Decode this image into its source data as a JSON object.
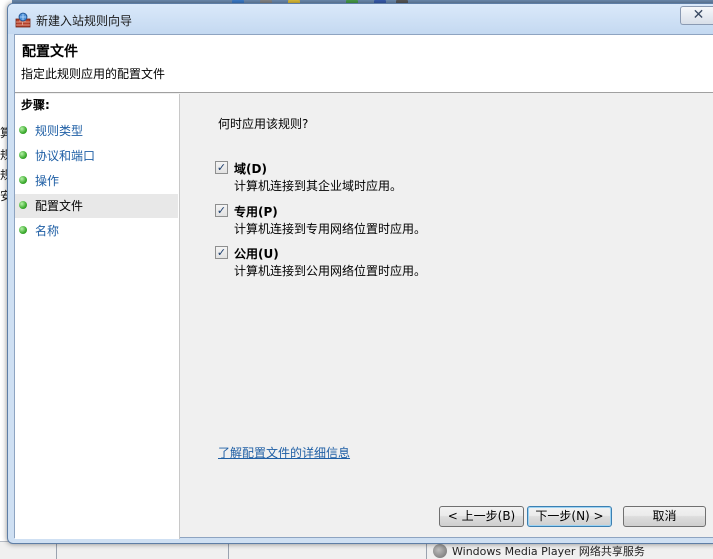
{
  "window": {
    "title": "新建入站规则向导",
    "close_label": "✕"
  },
  "header": {
    "title": "配置文件",
    "subtitle": "指定此规则应用的配置文件"
  },
  "steps": {
    "heading": "步骤:",
    "items": [
      {
        "label": "规则类型"
      },
      {
        "label": "协议和端口"
      },
      {
        "label": "操作"
      },
      {
        "label": "配置文件"
      },
      {
        "label": "名称"
      }
    ]
  },
  "main": {
    "question": "何时应用该规则?",
    "options": [
      {
        "label": "域(D)",
        "description": "计算机连接到其企业域时应用。",
        "checked": true
      },
      {
        "label": "专用(P)",
        "description": "计算机连接到专用网络位置时应用。",
        "checked": true
      },
      {
        "label": "公用(U)",
        "description": "计算机连接到公用网络位置时应用。",
        "checked": true
      }
    ],
    "learn_more": "了解配置文件的详细信息",
    "check_mark": "✓"
  },
  "buttons": {
    "back": "< 上一步(B)",
    "next": "下一步(N) >",
    "cancel": "取消"
  },
  "background": {
    "left_chars": [
      "算",
      "规",
      "规",
      "安"
    ],
    "taskbar_text": "Windows Media Player 网络共享服务"
  }
}
